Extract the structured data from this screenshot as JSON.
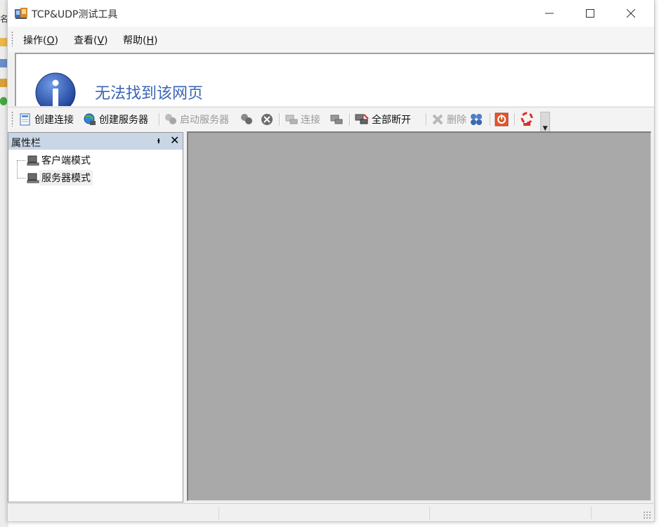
{
  "window": {
    "title": "TCP&UDP测试工具"
  },
  "menu": [
    {
      "label": "操作(",
      "key": "O",
      "suffix": ")"
    },
    {
      "label": "查看(",
      "key": "V",
      "suffix": ")"
    },
    {
      "label": "帮助(",
      "key": "H",
      "suffix": ")"
    }
  ],
  "webview": {
    "error_text": "无法找到该网页"
  },
  "toolbar": {
    "create_connection": "创建连接",
    "create_server": "创建服务器",
    "start_server": "启动服务器",
    "connect": "连接",
    "disconnect_all": "全部断开",
    "delete": "删除"
  },
  "panel": {
    "title": "属性栏",
    "pin_glyph": "ᵼ",
    "close_glyph": "✕",
    "items": [
      "客户端模式",
      "服务器模式"
    ]
  },
  "background": {
    "left_glyph": "名"
  },
  "colors": {
    "panel_header": "#c9d6e6",
    "mdi_background": "#a9a9a9",
    "link_blue": "#3b64b4"
  }
}
